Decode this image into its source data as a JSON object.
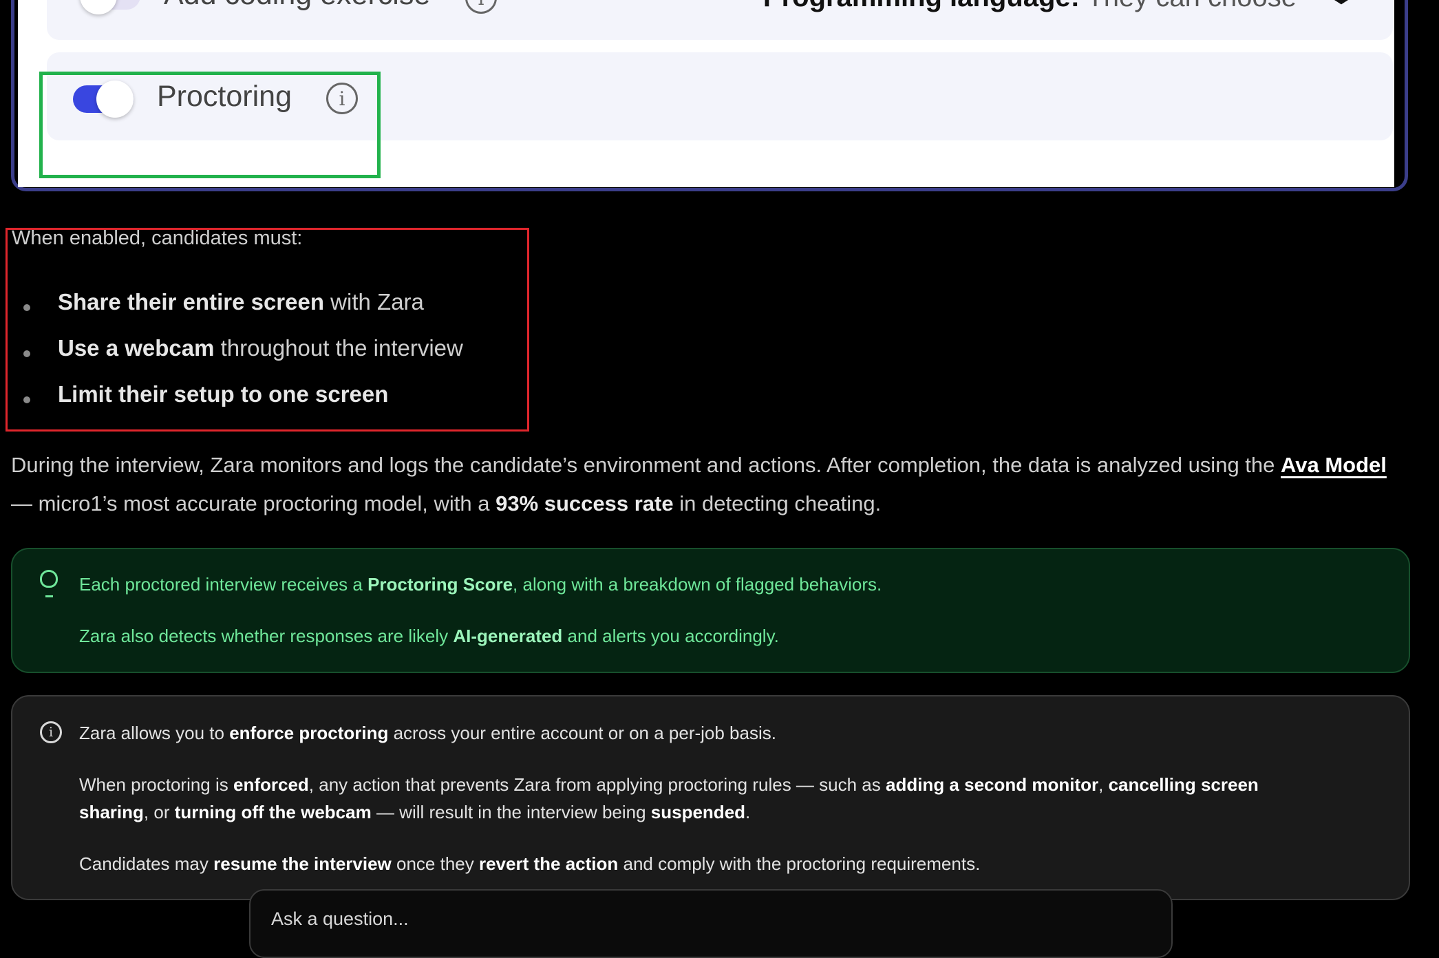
{
  "settings": {
    "coding_exercise_label": "Add coding exercise",
    "coding_exercise_enabled": false,
    "language_label": "Programming language:",
    "language_value": "They can choose",
    "proctoring_label": "Proctoring",
    "proctoring_enabled": true,
    "info_icon": "i",
    "chevron": "❯"
  },
  "colors": {
    "toggle_on": "#3946e0",
    "toggle_off": "#e4e1f4",
    "highlight_green": "#22b24c",
    "highlight_red": "#e0262c"
  },
  "enabled_section": {
    "intro": "When enabled, candidates must:",
    "bullets": [
      {
        "bold": "Share their entire screen",
        "rest": " with Zara"
      },
      {
        "bold": "Use a webcam",
        "rest": " throughout the interview"
      },
      {
        "bold": "Limit their setup to one screen",
        "rest": ""
      }
    ]
  },
  "description": {
    "part1": "During the interview, Zara monitors and logs the candidate’s environment and actions. After completion, the data is analyzed using the ",
    "link": "Ava Model",
    "part2": " — micro1’s most accurate proctoring model, with a ",
    "bold": "93% success rate",
    "part3": " in detecting cheating."
  },
  "tip": {
    "line1_a": "Each proctored interview receives a ",
    "line1_b": "Proctoring Score",
    "line1_c": ", along with a breakdown of flagged behaviors.",
    "line2_a": "Zara also detects whether responses are likely ",
    "line2_b": "AI-generated",
    "line2_c": " and alerts you accordingly."
  },
  "note": {
    "l1_a": "Zara allows you to ",
    "l1_b": "enforce proctoring",
    "l1_c": " across your entire account or on a per-job basis.",
    "l2_a": "When proctoring is ",
    "l2_b": "enforced",
    "l2_c": ", any action that prevents Zara from applying proctoring rules — such as ",
    "l2_d": "adding a second monitor",
    "l2_e": ", ",
    "l2_f": "cancelling screen",
    "l3_a": "sharing",
    "l3_b": ", or ",
    "l3_c": "turning off the webcam",
    "l3_d": " — will result in the interview being ",
    "l3_e": "suspended",
    "l3_f": ".",
    "l4_a": "Candidates may ",
    "l4_b": "resume the interview",
    "l4_c": " once they ",
    "l4_d": "revert the action",
    "l4_e": " and comply with the proctoring requirements."
  },
  "ask": {
    "placeholder": "Ask a question..."
  }
}
